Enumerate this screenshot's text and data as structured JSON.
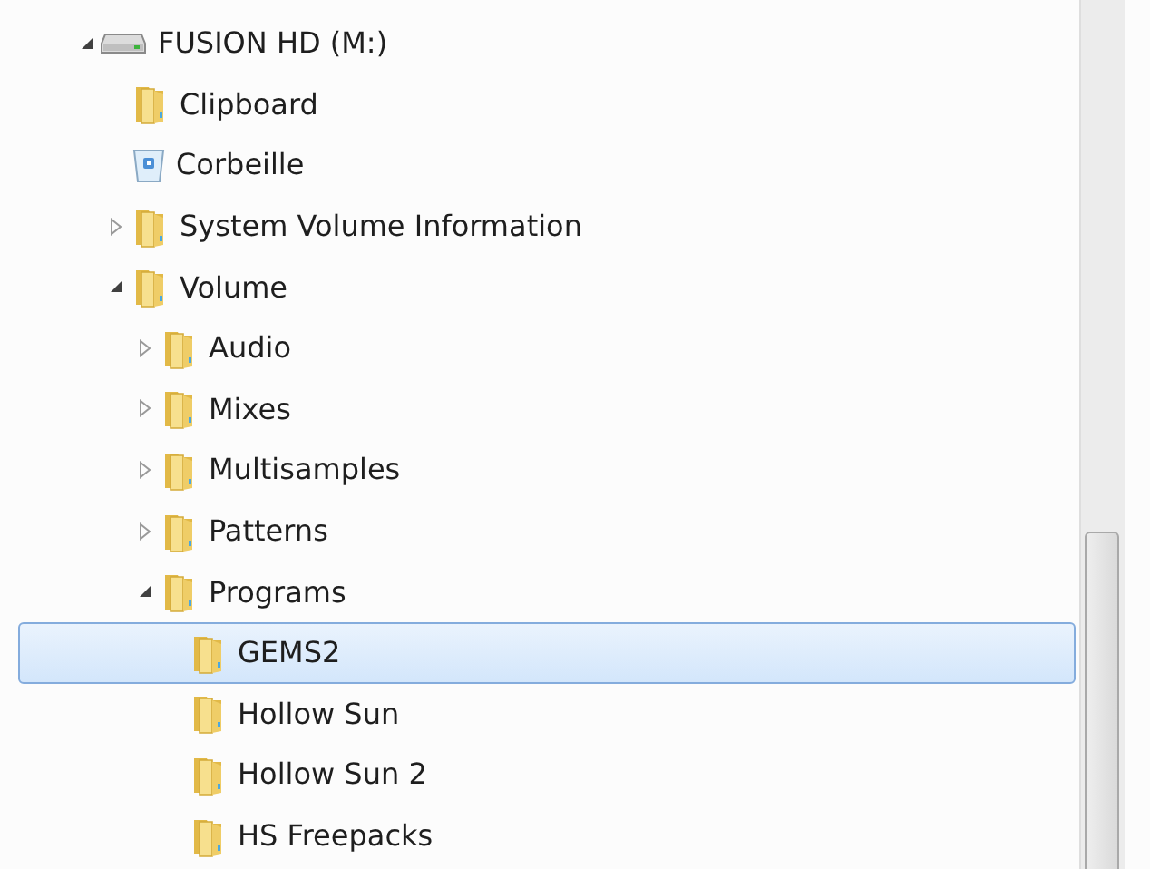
{
  "tree": [
    {
      "label": "FUSION HD (M:)",
      "kind": "drive",
      "expanded": true,
      "selected": false,
      "children": [
        {
          "label": "Clipboard",
          "kind": "folder",
          "selected": false
        },
        {
          "label": "Corbeille",
          "kind": "recycle",
          "selected": false
        },
        {
          "label": "System Volume Information",
          "kind": "folder",
          "expanded": false,
          "selected": false
        },
        {
          "label": "Volume",
          "kind": "folder",
          "expanded": true,
          "selected": false,
          "children": [
            {
              "label": "Audio",
              "kind": "folder",
              "expanded": false,
              "selected": false
            },
            {
              "label": "Mixes",
              "kind": "folder",
              "expanded": false,
              "selected": false
            },
            {
              "label": "Multisamples",
              "kind": "folder",
              "expanded": false,
              "selected": false
            },
            {
              "label": "Patterns",
              "kind": "folder",
              "expanded": false,
              "selected": false
            },
            {
              "label": "Programs",
              "kind": "folder",
              "expanded": true,
              "selected": false,
              "children": [
                {
                  "label": "GEMS2",
                  "kind": "folder",
                  "selected": true
                },
                {
                  "label": "Hollow Sun",
                  "kind": "folder",
                  "selected": false
                },
                {
                  "label": "Hollow Sun 2",
                  "kind": "folder",
                  "selected": false
                },
                {
                  "label": "HS Freepacks",
                  "kind": "folder",
                  "selected": false
                }
              ]
            }
          ]
        }
      ]
    }
  ]
}
